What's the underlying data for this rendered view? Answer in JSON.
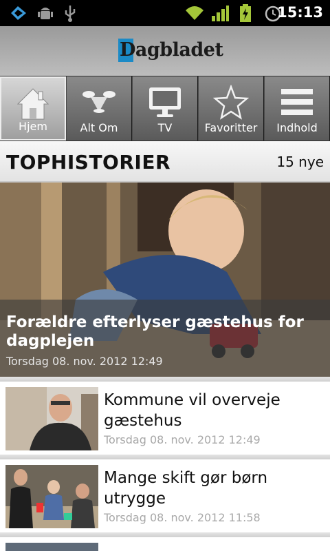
{
  "status_bar": {
    "time": "15:13",
    "left_icons": [
      "foursquare-icon",
      "android-debug-icon",
      "usb-icon"
    ],
    "right_icons": [
      "wifi-icon",
      "signal-icon",
      "battery-charging-icon",
      "alarm-icon"
    ],
    "accent": "#a4c639"
  },
  "header": {
    "logo_text": "Dagbladet",
    "logo_accent": "#1b8ac6"
  },
  "nav": {
    "items": [
      {
        "label": "Hjem",
        "icon": "house-icon",
        "active": true
      },
      {
        "label": "Alt Om",
        "icon": "spotlight-icon",
        "active": false
      },
      {
        "label": "TV",
        "icon": "tv-icon",
        "active": false
      },
      {
        "label": "Favoritter",
        "icon": "star-icon",
        "active": false
      },
      {
        "label": "Indhold",
        "icon": "menu-lines-icon",
        "active": false
      }
    ]
  },
  "section": {
    "title": "TOPHISTORIER",
    "count": "15 nye"
  },
  "hero": {
    "title": "Forældre efterlyser gæstehus for dagplejen",
    "date": "Torsdag 08. nov. 2012 12:49"
  },
  "articles": [
    {
      "title": "Kommune vil overveje gæstehus",
      "date": "Torsdag 08. nov. 2012 12:49"
    },
    {
      "title": "Mange skift gør børn utrygge",
      "date": "Torsdag 08. nov. 2012 11:58"
    }
  ]
}
